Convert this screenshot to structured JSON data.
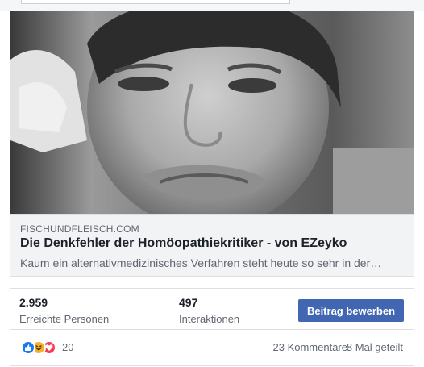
{
  "post": {
    "link_preview": {
      "domain": "FISCHUNDFLEISCH.COM",
      "title": "Die Denkfehler der Homöopathiekritiker - von EZeyko",
      "description": "Kaum ein alternativmedizinisches Verfahren steht heute so sehr in der…"
    },
    "insights": {
      "reach_value": "2.959",
      "reach_label": "Erreichte Personen",
      "engagement_value": "497",
      "engagement_label": "Interaktionen",
      "boost_label": "Beitrag bewerben"
    },
    "reactions": {
      "icons": [
        "like-icon",
        "haha-icon",
        "love-icon"
      ],
      "count": "20",
      "comments": "23 Kommentare",
      "shares": "8 Mal geteilt"
    }
  },
  "colors": {
    "boost_button": "#4267b2",
    "like": "#1877f2",
    "haha": "#f7b125",
    "love": "#f33e58",
    "link_box_bg": "#f2f3f5"
  }
}
